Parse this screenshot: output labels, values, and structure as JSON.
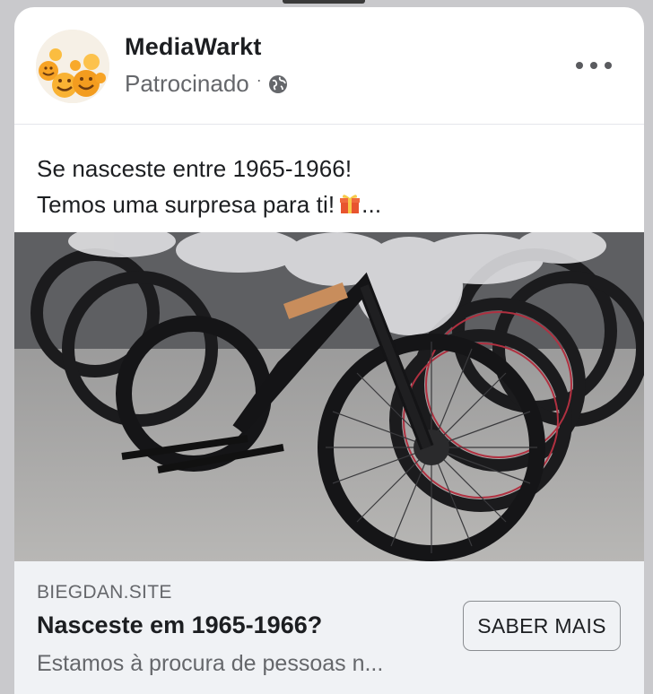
{
  "post": {
    "page_name": "MediaWarkt",
    "sponsored_label": "Patrocinado",
    "separator": "·",
    "avatar_icon": "emoji-faces-avatar-icon",
    "audience_icon": "globe-icon",
    "menu_icon": "more-options-icon",
    "text_line1": "Se nasceste entre 1965-1966!",
    "text_line2": "Temos uma surpresa para ti!",
    "text_emoji_icon": "gift-icon",
    "text_ellipsis": "...",
    "image_icon": "e-bikes-row-photo"
  },
  "link_preview": {
    "domain": "BIEGDAN.SITE",
    "headline": "Nasceste em 1965-1966?",
    "description": "Estamos à procura de pessoas n...",
    "cta_label": "SABER MAIS"
  },
  "colors": {
    "card_bg": "#ffffff",
    "footer_bg": "#f0f2f5",
    "primary_text": "#1c1e21",
    "secondary_text": "#65676b"
  }
}
